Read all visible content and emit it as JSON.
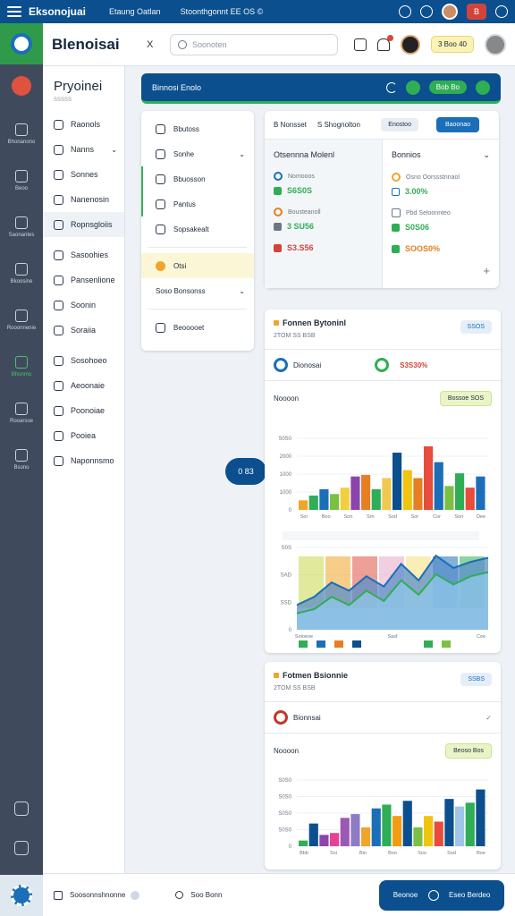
{
  "topbar": {
    "app_title": "Eksonojuai",
    "links": [
      "Etaung Oatlan",
      "Stoonthgonnt EE OS ©"
    ],
    "badge": "B"
  },
  "header": {
    "brand": "Blenoisai",
    "collapse_label": "X",
    "search_placeholder": "Soonoten",
    "user_badge": "3 Boo 40"
  },
  "nav": {
    "title": "Pryoinei",
    "subtitle": "SSSSS",
    "items": [
      {
        "label": "Raonols",
        "caret": false
      },
      {
        "label": "Nanns",
        "caret": true
      },
      {
        "label": "Sonnes",
        "caret": false
      },
      {
        "label": "Nanenosin",
        "caret": false
      },
      {
        "label": "Ropnsgloiis",
        "caret": false
      },
      {
        "label": "Sasoohies",
        "caret": false
      },
      {
        "label": "Pansenlione",
        "caret": false
      },
      {
        "label": "Soonin",
        "caret": false
      },
      {
        "label": "Soraiia",
        "caret": false
      },
      {
        "label": "Sosohoeo",
        "caret": false
      },
      {
        "label": "Aeoonaie",
        "caret": false
      },
      {
        "label": "Poonoiae",
        "caret": false
      },
      {
        "label": "Pooiea",
        "caret": false
      },
      {
        "label": "Naponnsmo",
        "caret": false
      }
    ]
  },
  "rail": {
    "items": [
      "",
      "Bhonanono",
      "Beoo",
      "Saonantes",
      "Bkoosine",
      "Rooonnenie",
      "Bhonmo",
      "Rooarsoe",
      "Bsono"
    ]
  },
  "banner": {
    "title": "Binnosi Enolo",
    "button": "Bob Bo"
  },
  "submenu": {
    "items": [
      "Bbutoss",
      "Sonhe",
      "Bbuosson",
      "Pantus",
      "Sopsakealt"
    ],
    "highlight": "Otsi",
    "group": "Soso Bonsonss",
    "footer": "Beooooet"
  },
  "panel1": {
    "tabs": [
      "B Nonsset",
      "S Shognolton"
    ],
    "btn_secondary": "Enostoo",
    "btn_primary": "Baoonao",
    "left_title": "Otsennna Molenl",
    "right_title": "Bonnios",
    "left_metrics": [
      {
        "label": "Nomooos",
        "value": "S6S0S"
      },
      {
        "label": "Bousteanoll",
        "value": "3 SU56"
      },
      {
        "label": "",
        "value": "S3.S56"
      }
    ],
    "right_metrics": [
      {
        "label": "Osno Oorssstnnaol",
        "value": "3.00%"
      },
      {
        "label": "Pbd Seloonnteo",
        "value": "S0S06"
      },
      {
        "label": "",
        "value": "SOOS0%"
      }
    ]
  },
  "panel2": {
    "title": "Fonnen Bytoninl",
    "subtitle": "2TOM SS BSB",
    "badge": "SSOS",
    "row_label": "Dionosai",
    "row_value": "S3S30%",
    "section": "Noooon",
    "section_badge": "Bossoe SOS"
  },
  "panel3": {
    "title": "Fotmen Bsionnie",
    "subtitle": "2TOM SS BSB",
    "badge": "SSBS",
    "row_label": "Bionnsai",
    "section": "Noooon",
    "section_badge": "Beoso Bos"
  },
  "float_pill": "0 83",
  "footer": {
    "left_label": "Soosonnshnonne",
    "mid_label": "Soo Bonn",
    "button_left": "Beonoe",
    "button_right": "Eseo Berdeo"
  },
  "chart_data": [
    {
      "type": "bar",
      "ytick_labels": [
        "S0S0",
        "2000",
        "1000",
        "1000",
        "0"
      ],
      "xtick_labels": [
        "Sor",
        "Boo",
        "Son",
        "Srn",
        "Sod",
        "Sor",
        "Cor",
        "Sori",
        "Dee"
      ],
      "values": [
        0.6,
        0.9,
        1.3,
        1.0,
        1.4,
        2.1,
        2.2,
        1.3,
        2.0,
        3.6,
        2.5,
        2.0,
        4.0,
        3.0,
        1.5,
        2.3,
        1.4,
        2.1
      ],
      "colors": [
        "#f0a429",
        "#2fae55",
        "#1a6fb8",
        "#7bc043",
        "#f0d040",
        "#8e44ad",
        "#e67e22",
        "#2fae55",
        "#f0c850",
        "#0b4f8e",
        "#f1c40f",
        "#e67e22",
        "#e74c3c",
        "#1a6fb8",
        "#7bc043",
        "#2fae55",
        "#e74c3c",
        "#1a6fb8"
      ],
      "ylim": [
        0,
        4.5
      ]
    },
    {
      "type": "area",
      "ytick_labels": [
        "S0S",
        "SAD",
        "SSD",
        "0"
      ],
      "xtick_labels": [
        "Soioeoe",
        "Sasf",
        "Coe"
      ],
      "series": [
        {
          "values": [
            1.2,
            1.6,
            2.3,
            1.9,
            2.6,
            2.1,
            3.2,
            2.4,
            3.6,
            3.0,
            3.3,
            3.5
          ]
        },
        {
          "values": [
            0.8,
            1.0,
            1.6,
            1.2,
            1.9,
            1.4,
            2.4,
            1.7,
            2.7,
            2.2,
            2.6,
            2.8
          ]
        }
      ],
      "ylim": [
        0,
        4
      ]
    },
    {
      "type": "bar",
      "ytick_labels": [
        "S0S0",
        "S0S0",
        "S0S0",
        "S0S0",
        "0"
      ],
      "xtick_labels": [
        "Bbb",
        "Soi",
        "Bin",
        "Boo",
        "Soo",
        "Sod",
        "Boe"
      ],
      "values": [
        0.3,
        1.2,
        0.6,
        0.7,
        1.5,
        1.7,
        1.0,
        2.0,
        2.2,
        1.6,
        2.4,
        1.0,
        1.6,
        1.3,
        2.5,
        2.1,
        2.3,
        3.0
      ],
      "colors": [
        "#2fae55",
        "#0b4f8e",
        "#8e44ad",
        "#e84393",
        "#9b59b6",
        "#8e7cc3",
        "#f0a429",
        "#1a6fb8",
        "#2fae55",
        "#f39c12",
        "#0b4f8e",
        "#7bc043",
        "#f1c40f",
        "#e74c3c",
        "#0b4f8e",
        "#9fc5e8",
        "#2fae55",
        "#0b4f8e"
      ],
      "ylim": [
        0,
        3.5
      ]
    }
  ]
}
